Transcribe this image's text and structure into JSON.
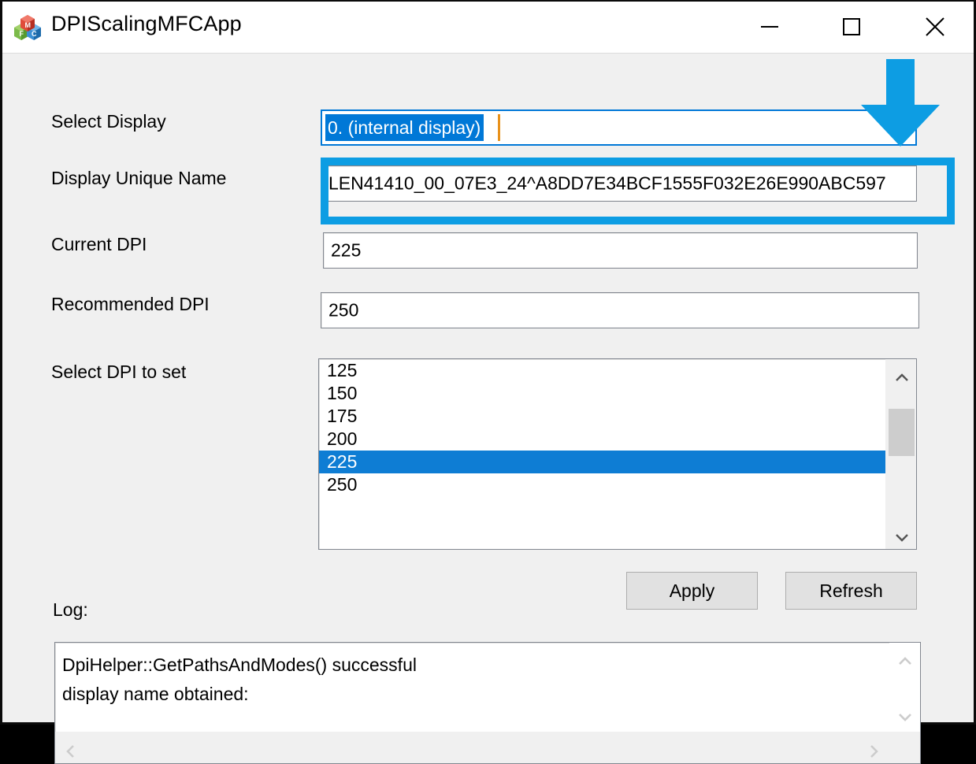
{
  "window": {
    "title": "DPIScalingMFCApp",
    "icon": "mfc-app-icon",
    "controls": {
      "minimize": "minimize-icon",
      "maximize": "maximize-icon",
      "close": "close-icon"
    }
  },
  "form": {
    "labels": {
      "select_display": "Select Display",
      "display_unique_name": "Display Unique Name",
      "current_dpi": "Current DPI",
      "recommended_dpi": "Recommended DPI",
      "select_dpi_to_set": "Select DPI to set",
      "log": "Log:"
    },
    "select_display": {
      "value": "0. (internal display)",
      "selected": true
    },
    "display_unique_name": {
      "value": "LEN41410_00_07E3_24^A8DD7E34BCF1555F032E26E990ABC597"
    },
    "current_dpi": {
      "value": "225"
    },
    "recommended_dpi": {
      "value": "250"
    },
    "dpi_list": {
      "options": [
        "125",
        "150",
        "175",
        "200",
        "225",
        "250"
      ],
      "selected_value": "225",
      "selected_index": 4,
      "scroll_up_icon": "chevron-up-icon",
      "scroll_down_icon": "chevron-down-icon"
    },
    "buttons": {
      "apply": "Apply",
      "refresh": "Refresh"
    },
    "log_output": {
      "lines": [
        "DpiHelper::GetPathsAndModes() successful",
        "display name obtained:"
      ],
      "text": "DpiHelper::GetPathsAndModes() successful\ndisplay name obtained:",
      "scroll_up_icon": "chevron-up-icon-disabled",
      "scroll_down_icon": "chevron-down-icon-disabled",
      "scroll_left_icon": "chevron-left-icon-disabled",
      "scroll_right_icon": "chevron-right-icon-disabled"
    }
  },
  "annotations": {
    "highlight_color": "#0d9de3",
    "highlight_target": "display-unique-name-field",
    "arrow_icon": "down-arrow-annotation",
    "arrow_target": "select-display-combo"
  },
  "colors": {
    "accent_selection": "#0078d7",
    "list_selection": "#0e7dd4",
    "caret": "#e8911a",
    "client_background": "#f0f0f0",
    "title_background": "#ffffff",
    "annotation_cyan": "#0d9de3"
  }
}
